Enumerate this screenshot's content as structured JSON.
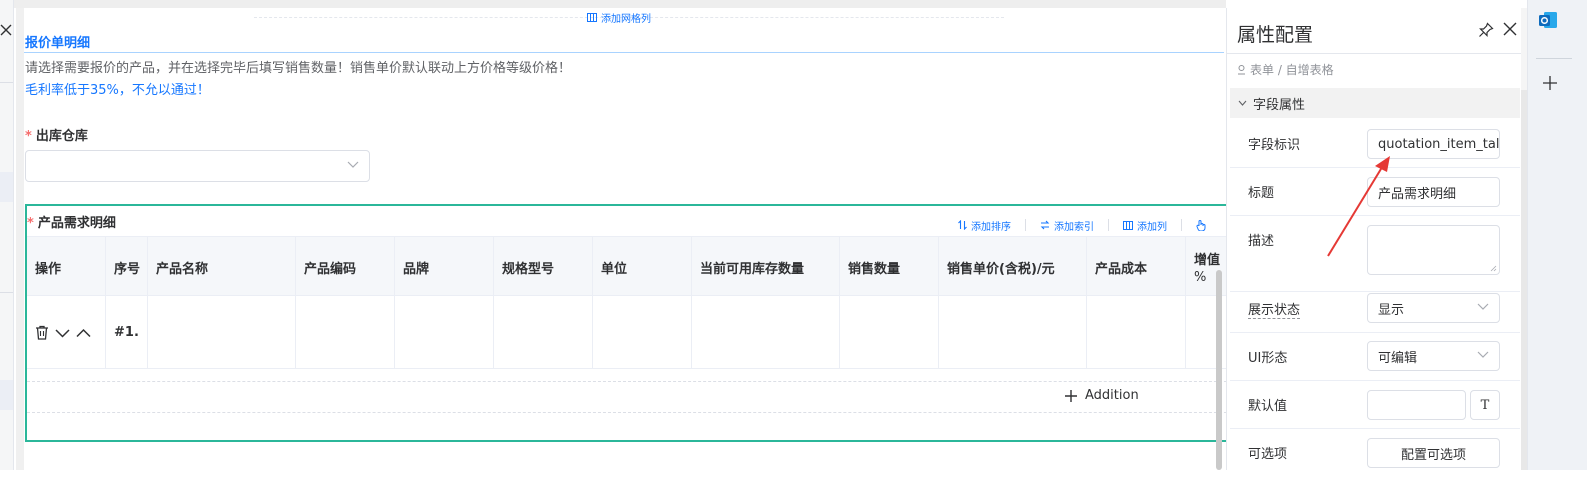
{
  "canvas": {
    "add_grid_col": "添加网格列",
    "section_title": "报价单明细",
    "desc_line1": "请选择需要报价的产品，并在选择完毕后填写销售数量！销售单价默认联动上方价格等级价格！",
    "desc_line2": "毛利率低于35%，不允以通过！",
    "warehouse_label": "出库仓库",
    "warehouse_value": "",
    "required_mark": "*"
  },
  "table": {
    "label": "产品需求明细",
    "columns": [
      "操作",
      "序号",
      "产品名称",
      "产品编码",
      "品牌",
      "规格型号",
      "单位",
      "当前可用库存数量",
      "销售数量",
      "销售单价(含税)/元",
      "产品成本",
      "增值",
      "%"
    ],
    "row": {
      "index": "#1."
    },
    "addition_label": "Addition",
    "actions": [
      "添加排序",
      "添加索引",
      "添加列"
    ]
  },
  "panel": {
    "title": "属性配置",
    "breadcrumb": "表单 / 自增表格",
    "section": "字段属性",
    "fields": {
      "field_id_label": "字段标识",
      "field_id_value": "quotation_item_tal",
      "title_label": "标题",
      "title_value": "产品需求明细",
      "desc_label": "描述",
      "display_label": "展示状态",
      "display_value": "显示",
      "ui_label": "UI形态",
      "ui_value": "可编辑",
      "default_label": "默认值",
      "default_value": "",
      "t_button": "T",
      "options_label": "可选项",
      "options_button": "配置可选项"
    }
  },
  "colors": {
    "accent": "#1677ff",
    "table_border": "#2bb79a",
    "required": "#f56c6c",
    "arrow": "#e53935",
    "outlook": "#0f6cbd"
  },
  "icons": [
    "close-icon",
    "grid-column-icon",
    "chevron-down-icon",
    "trash-icon",
    "chevron-up-icon",
    "plus-icon",
    "sort-icon",
    "index-icon",
    "column-icon",
    "hand-icon",
    "pin-icon",
    "location-icon",
    "outlook-icon"
  ]
}
